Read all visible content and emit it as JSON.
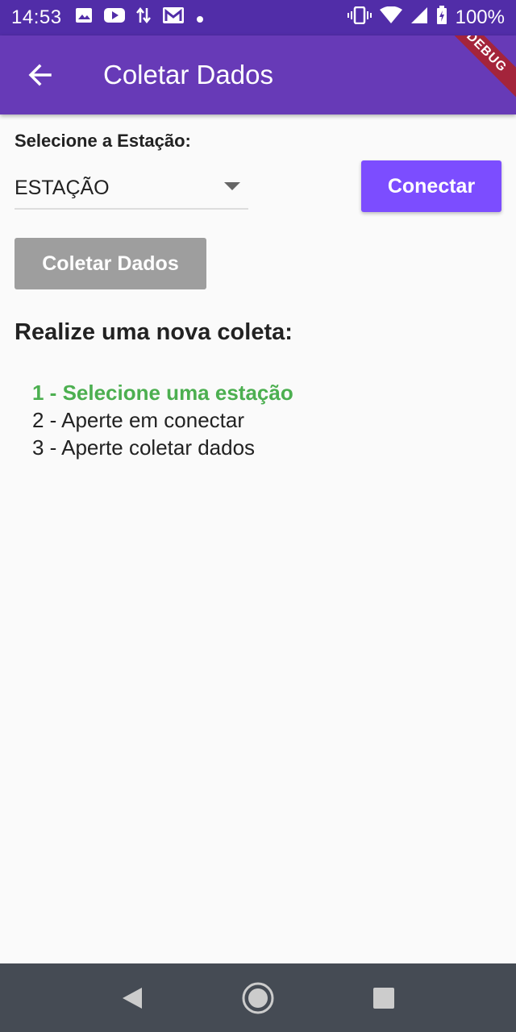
{
  "status_bar": {
    "time": "14:53",
    "battery": "100%",
    "left_icons": [
      "image-icon",
      "youtube-icon",
      "data-transfer-icon",
      "gmail-icon",
      "dot-icon"
    ],
    "right_icons": [
      "vibrate-icon",
      "wifi-icon",
      "signal-icon",
      "battery-icon"
    ]
  },
  "app_bar": {
    "title": "Coletar Dados",
    "back_icon": "arrow-back-icon",
    "debug_label": "DEBUG",
    "color": "#673ab7"
  },
  "form": {
    "select_label": "Selecione a Estação:",
    "dropdown_value": "ESTAÇÃO",
    "connect_label": "Conectar",
    "collect_label": "Coletar Dados"
  },
  "instructions": {
    "title": "Realize uma nova coleta:",
    "steps": [
      "1 - Selecione uma estação",
      "2 - Aperte em conectar",
      "3 - Aperte coletar dados"
    ],
    "active_step_color": "#4caf50"
  },
  "nav_bar": {
    "icons": [
      "back-triangle-icon",
      "home-circle-icon",
      "recents-square-icon"
    ]
  }
}
